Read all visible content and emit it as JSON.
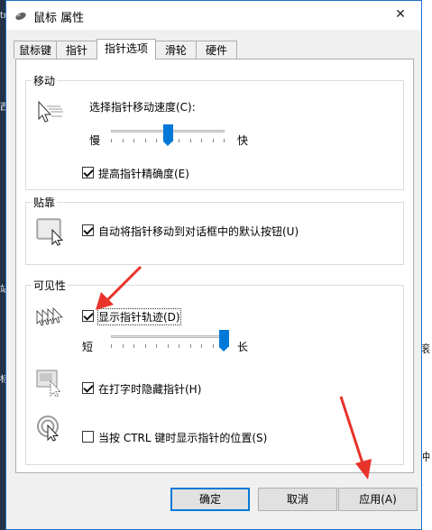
{
  "desktop": {
    "left_fragments": [
      "tr",
      "西",
      "站",
      "标"
    ],
    "right_fragments": [
      "滚",
      "冲"
    ]
  },
  "window": {
    "title": "鼠标 属性",
    "close_glyph": "✕"
  },
  "tabs": [
    {
      "label": "鼠标键",
      "active": false
    },
    {
      "label": "指针",
      "active": false
    },
    {
      "label": "指针选项",
      "active": true
    },
    {
      "label": "滑轮",
      "active": false
    },
    {
      "label": "硬件",
      "active": false
    }
  ],
  "motion": {
    "group_label": "移动",
    "speed_label": "选择指针移动速度(C):",
    "slow_label": "慢",
    "fast_label": "快",
    "speed_value": 0.5,
    "precision_label": "提高指针精确度(E)",
    "precision_checked": true
  },
  "snap": {
    "group_label": "贴靠",
    "snap_label": "自动将指针移动到对话框中的默认按钮(U)",
    "snap_checked": true
  },
  "visibility": {
    "group_label": "可见性",
    "trails_label": "显示指针轨迹(D)",
    "trails_checked": true,
    "short_label": "短",
    "long_label": "长",
    "trails_value": 1.0,
    "hide_label": "在打字时隐藏指针(H)",
    "hide_checked": true,
    "ctrl_label": "当按 CTRL 键时显示指针的位置(S)",
    "ctrl_checked": false
  },
  "buttons": {
    "ok": "确定",
    "cancel": "取消",
    "apply": "应用(A)"
  },
  "annotation_color": "#e8332a",
  "accent_color": "#0078d7"
}
